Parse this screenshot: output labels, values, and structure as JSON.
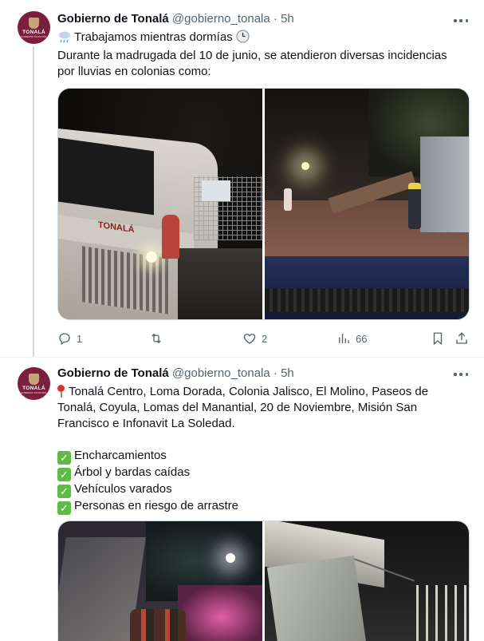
{
  "tweets": [
    {
      "author": {
        "name": "Gobierno de Tonalá",
        "handle": "@gobierno_tonala",
        "time": "5h",
        "avatar_text": "TONALÁ",
        "avatar_subtext": "GOBIERNO MUNICIPAL"
      },
      "text_lines": [
        "Trabajamos mientras dormías",
        "Durante la madrugada del 10 de junio, se atendieron diversas incidencias",
        "por lluvias en colonias como:"
      ],
      "icons": {
        "lead": "cloud-rain-icon",
        "trail": "clock-icon"
      },
      "media": [
        {
          "kind": "photo",
          "brand_text": "TONALÁ"
        },
        {
          "kind": "photo"
        }
      ],
      "actions": {
        "reply": {
          "icon": "reply-icon",
          "count": "1"
        },
        "retweet": {
          "icon": "retweet-icon",
          "count": ""
        },
        "like": {
          "icon": "heart-icon",
          "count": "2"
        },
        "views": {
          "icon": "views-icon",
          "count": "66"
        },
        "bookmark": {
          "icon": "bookmark-icon"
        },
        "share": {
          "icon": "share-icon"
        }
      }
    },
    {
      "author": {
        "name": "Gobierno de Tonalá",
        "handle": "@gobierno_tonala",
        "time": "5h",
        "avatar_text": "TONALÁ",
        "avatar_subtext": "GOBIERNO MUNICIPAL"
      },
      "text_lines": [
        "Tonalá Centro, Loma Dorada, Colonia Jalisco, El Molino, Paseos de",
        "Tonalá, Coyula, Lomas del Manantial, 20 de Noviembre, Misión San",
        "Francisco e Infonavit La Soledad."
      ],
      "checklist": [
        "Encharcamientos",
        "Árbol y bardas caídas",
        "Vehículos varados",
        "Personas en riesgo de arrastre"
      ],
      "media": [
        {
          "kind": "photo"
        },
        {
          "kind": "photo"
        }
      ]
    }
  ],
  "colors": {
    "text": "#0f1419",
    "secondary": "#536471",
    "border": "#cfd9de",
    "avatar_bg": "#7a1f3d",
    "check": "#5dbb46"
  }
}
